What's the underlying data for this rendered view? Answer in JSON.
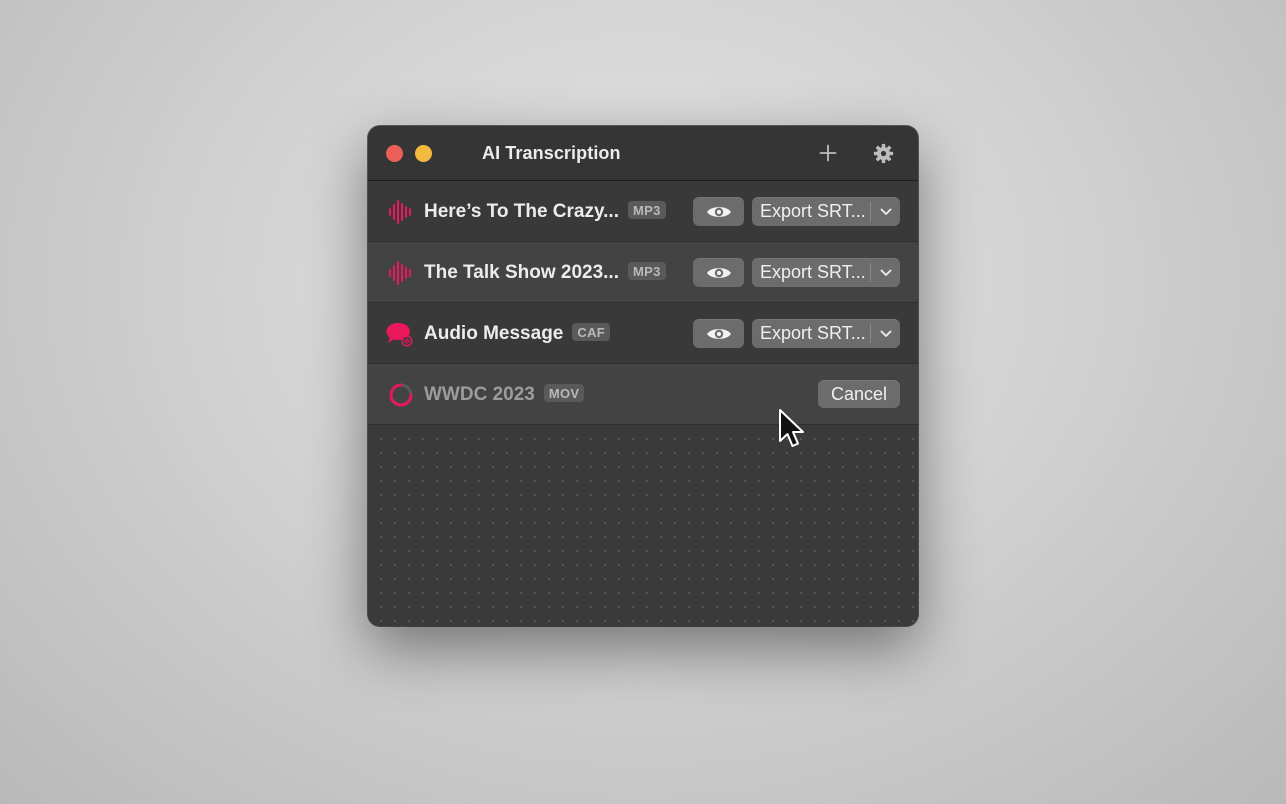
{
  "window": {
    "title": "AI Transcription",
    "add_icon": "plus-icon",
    "settings_icon": "gear-icon"
  },
  "colors": {
    "accent": "#e8185a",
    "close": "#ec5f58",
    "minimize": "#f2bb3f"
  },
  "files": [
    {
      "name": "Here’s To The Crazy...",
      "format": "MP3",
      "icon": "waveform-icon",
      "status": "done",
      "preview_icon": "eye-icon",
      "export_label": "Export SRT..."
    },
    {
      "name": "The Talk Show 2023...",
      "format": "MP3",
      "icon": "waveform-icon",
      "status": "done",
      "preview_icon": "eye-icon",
      "export_label": "Export SRT..."
    },
    {
      "name": "Audio Message",
      "format": "CAF",
      "icon": "speech-bubble-icon",
      "status": "done",
      "preview_icon": "eye-icon",
      "export_label": "Export SRT..."
    },
    {
      "name": "WWDC 2023",
      "format": "MOV",
      "icon": "progress-spinner-icon",
      "status": "processing",
      "cancel_label": "Cancel"
    }
  ]
}
